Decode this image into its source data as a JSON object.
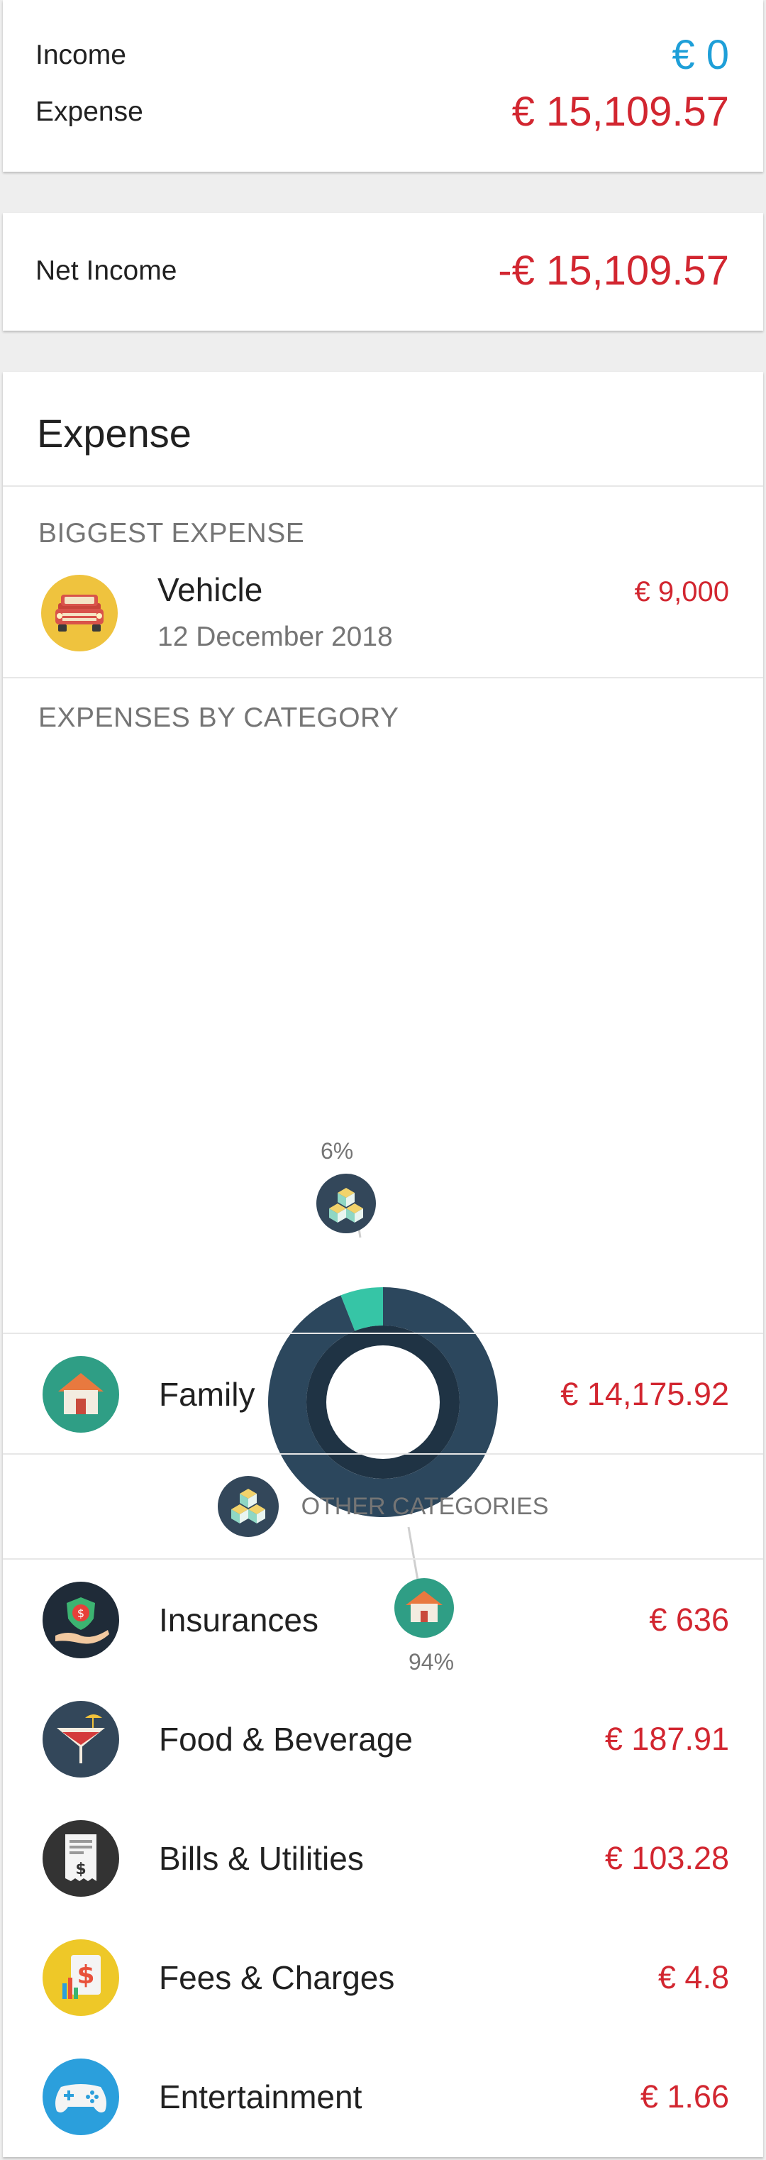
{
  "summary": {
    "income_label": "Income",
    "income_value": "€ 0",
    "expense_label": "Expense",
    "expense_value": "€ 15,109.57"
  },
  "net": {
    "label": "Net Income",
    "value": "-€ 15,109.57"
  },
  "expense_card": {
    "title": "Expense",
    "biggest_header": "BIGGEST EXPENSE",
    "biggest": {
      "name": "Vehicle",
      "date": "12 December 2018",
      "amount": "€ 9,000",
      "icon": "car-icon"
    },
    "by_category_header": "EXPENSES BY CATEGORY",
    "chart_data": {
      "type": "pie",
      "categories": [
        "Other categories",
        "Family"
      ],
      "values": [
        6,
        94
      ],
      "labels": [
        "6%",
        "94%"
      ]
    },
    "family": {
      "name": "Family",
      "amount": "€ 14,175.92",
      "icon": "house-icon"
    },
    "other_label": "OTHER CATEGORIES",
    "categories": [
      {
        "name": "Insurances",
        "amount": "€ 636",
        "icon": "insurance-icon",
        "color": "#1f2b38"
      },
      {
        "name": "Food & Beverage",
        "amount": "€ 187.91",
        "icon": "cocktail-icon",
        "color": "#33475a"
      },
      {
        "name": "Bills & Utilities",
        "amount": "€ 103.28",
        "icon": "bill-icon",
        "color": "#333333"
      },
      {
        "name": "Fees & Charges",
        "amount": "€ 4.8",
        "icon": "fees-icon",
        "color": "#eec828"
      },
      {
        "name": "Entertainment",
        "amount": "€ 1.66",
        "icon": "gamepad-icon",
        "color": "#2b9fdc"
      }
    ]
  }
}
